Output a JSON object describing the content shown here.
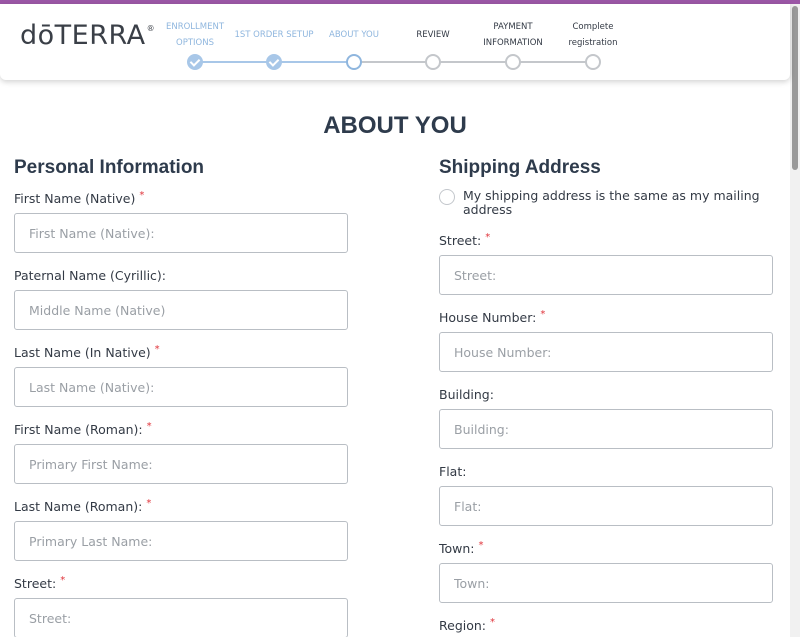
{
  "brand": {
    "logo_text": "dōTERRA",
    "logo_mark": "®",
    "accent_color": "#9b57a6"
  },
  "progress": {
    "steps": [
      {
        "label": "ENROLLMENT\nOPTIONS",
        "status": "done"
      },
      {
        "label": "1ST ORDER SETUP",
        "status": "done"
      },
      {
        "label": "ABOUT YOU",
        "status": "current"
      },
      {
        "label": "REVIEW",
        "status": "pending"
      },
      {
        "label": "PAYMENT\nINFORMATION",
        "status": "pending"
      },
      {
        "label": "Complete\nregistration",
        "status": "pending"
      }
    ]
  },
  "page": {
    "title": "ABOUT YOU"
  },
  "personal": {
    "title": "Personal Information",
    "fields": [
      {
        "label": "First Name (Native)",
        "required": true,
        "placeholder": "First Name (Native):"
      },
      {
        "label": "Paternal Name (Cyrillic):",
        "required": false,
        "placeholder": "Middle Name (Native)"
      },
      {
        "label": "Last Name (In Native)",
        "required": true,
        "placeholder": "Last Name (Native):"
      },
      {
        "label": "First Name (Roman):",
        "required": true,
        "placeholder": "Primary First Name:"
      },
      {
        "label": "Last Name (Roman):",
        "required": true,
        "placeholder": "Primary Last Name:"
      },
      {
        "label": "Street:",
        "required": true,
        "placeholder": "Street:"
      }
    ]
  },
  "shipping": {
    "title": "Shipping Address",
    "same_as_mailing_label": "My shipping address is the same as my mailing address",
    "fields": [
      {
        "label": "Street:",
        "required": true,
        "placeholder": "Street:"
      },
      {
        "label": "House Number:",
        "required": true,
        "placeholder": "House Number:"
      },
      {
        "label": "Building:",
        "required": false,
        "placeholder": "Building:"
      },
      {
        "label": "Flat:",
        "required": false,
        "placeholder": "Flat:"
      },
      {
        "label": "Town:",
        "required": true,
        "placeholder": "Town:"
      },
      {
        "label": "Region:",
        "required": true,
        "placeholder": ""
      }
    ]
  },
  "required_marker": "*"
}
